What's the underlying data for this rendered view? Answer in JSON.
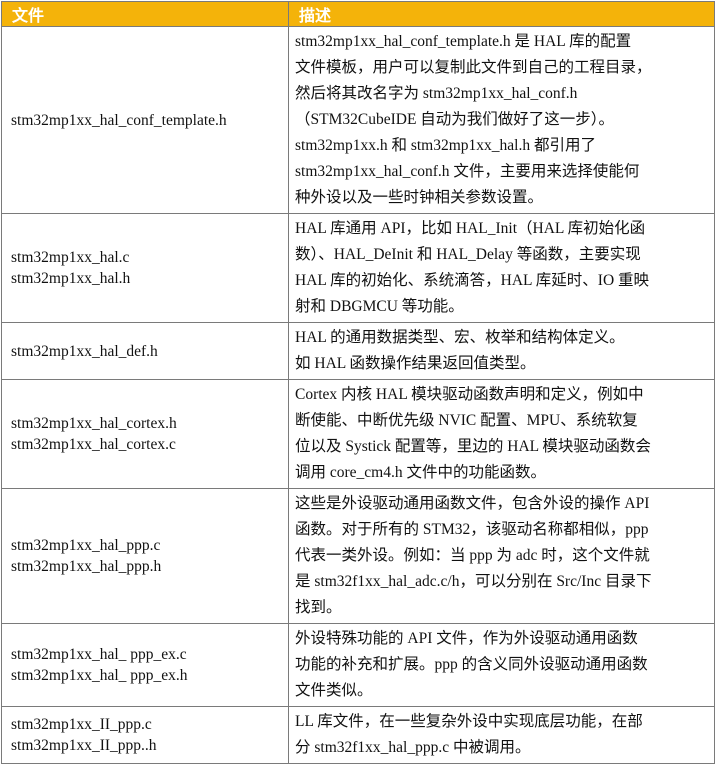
{
  "header": {
    "file": "文件",
    "desc": "描述"
  },
  "rows": [
    {
      "files": [
        "stm32mp1xx_hal_conf_template.h"
      ],
      "desc": [
        " stm32mp1xx_hal_conf_template.h 是 HAL 库的配置",
        "文件模板，用户可以复制此文件到自己的工程目录，",
        "然后将其改名字为 stm32mp1xx_hal_conf.h",
        "（STM32CubeIDE 自动为我们做好了这一步）。",
        "stm32mp1xx.h 和 stm32mp1xx_hal.h 都引用了",
        "stm32mp1xx_hal_conf.h 文件，主要用来选择使能何",
        "种外设以及一些时钟相关参数设置。"
      ]
    },
    {
      "files": [
        "stm32mp1xx_hal.c",
        "stm32mp1xx_hal.h"
      ],
      "desc": [
        "HAL 库通用 API，比如 HAL_Init（HAL 库初始化函",
        "数）、HAL_DeInit 和 HAL_Delay 等函数，主要实现",
        "HAL 库的初始化、系统滴答，HAL 库延时、IO 重映",
        "射和 DBGMCU 等功能。"
      ]
    },
    {
      "files": [
        "stm32mp1xx_hal_def.h"
      ],
      "desc": [
        "HAL 的通用数据类型、宏、枚举和结构体定义。",
        "如 HAL 函数操作结果返回值类型。"
      ]
    },
    {
      "files": [
        "stm32mp1xx_hal_cortex.h",
        "stm32mp1xx_hal_cortex.c"
      ],
      "desc": [
        "Cortex 内核 HAL 模块驱动函数声明和定义，例如中",
        "断使能、中断优先级 NVIC 配置、MPU、系统软复",
        "位以及 Systick 配置等，里边的 HAL 模块驱动函数会",
        "调用 core_cm4.h 文件中的功能函数。"
      ]
    },
    {
      "files": [
        "stm32mp1xx_hal_ppp.c",
        "stm32mp1xx_hal_ppp.h"
      ],
      "desc": [
        "这些是外设驱动通用函数文件，包含外设的操作 API",
        "函数。对于所有的 STM32，该驱动名称都相似，ppp",
        "代表一类外设。例如：当 ppp 为 adc 时，这个文件就",
        "是 stm32f1xx_hal_adc.c/h，可以分别在 Src/Inc 目录下",
        "找到。"
      ]
    },
    {
      "files": [
        "stm32mp1xx_hal_ ppp_ex.c",
        "stm32mp1xx_hal_  ppp_ex.h"
      ],
      "desc": [
        "外设特殊功能的 API 文件，作为外设驱动通用函数",
        "功能的补充和扩展。ppp 的含义同外设驱动通用函数",
        "文件类似。"
      ]
    },
    {
      "files": [
        "stm32mp1xx_II_ppp.c",
        "stm32mp1xx_II_ppp..h"
      ],
      "desc": [
        "LL 库文件，在一些复杂外设中实现底层功能，在部",
        "分 stm32f1xx_hal_ppp.c 中被调用。"
      ]
    }
  ]
}
